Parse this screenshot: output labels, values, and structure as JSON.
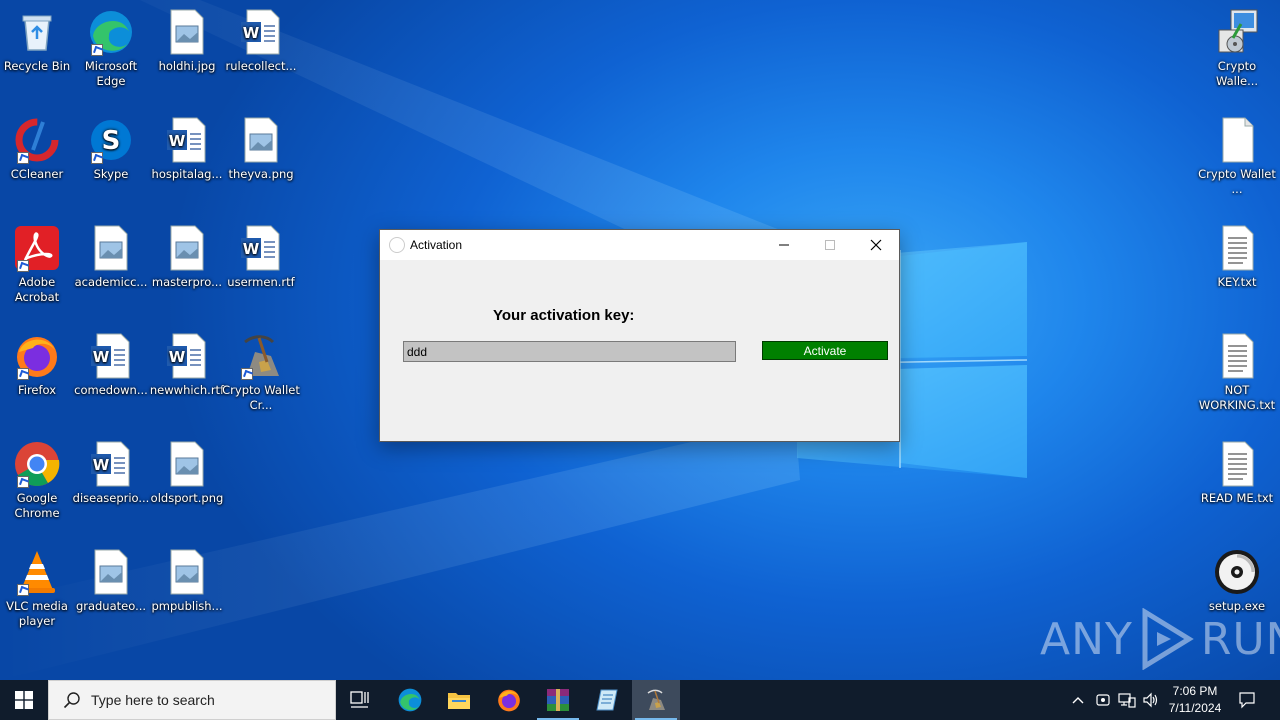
{
  "desktop": {
    "icons": [
      {
        "id": "recycle-bin",
        "label": "Recycle Bin"
      },
      {
        "id": "microsoft-edge",
        "label": "Microsoft Edge"
      },
      {
        "id": "holdhi",
        "label": "holdhi.jpg"
      },
      {
        "id": "rulecollect",
        "label": "rulecollect..."
      },
      {
        "id": "ccleaner",
        "label": "CCleaner"
      },
      {
        "id": "skype",
        "label": "Skype"
      },
      {
        "id": "hospitalag",
        "label": "hospitalag..."
      },
      {
        "id": "theyva",
        "label": "theyva.png"
      },
      {
        "id": "adobe-acrobat",
        "label": "Adobe Acrobat"
      },
      {
        "id": "academicc",
        "label": "academicc..."
      },
      {
        "id": "masterpro",
        "label": "masterpro..."
      },
      {
        "id": "usermen",
        "label": "usermen.rtf"
      },
      {
        "id": "firefox",
        "label": "Firefox"
      },
      {
        "id": "comedown",
        "label": "comedown..."
      },
      {
        "id": "newwhich",
        "label": "newwhich.rtf"
      },
      {
        "id": "crypto-wallet-cr",
        "label": "Crypto Wallet Cr..."
      },
      {
        "id": "google-chrome",
        "label": "Google Chrome"
      },
      {
        "id": "diseasepri",
        "label": "diseaseprio..."
      },
      {
        "id": "oldsport",
        "label": "oldsport.png"
      },
      {
        "id": "vlc",
        "label": "VLC media player"
      },
      {
        "id": "graduateo",
        "label": "graduateo..."
      },
      {
        "id": "pmpublish",
        "label": "pmpublish..."
      },
      {
        "id": "crypto-walle-setup",
        "label": "Crypto Walle..."
      },
      {
        "id": "crypto-wallet-file",
        "label": "Crypto Wallet ..."
      },
      {
        "id": "key-txt",
        "label": "KEY.txt"
      },
      {
        "id": "not-working-txt",
        "label": "NOT WORKING.txt"
      },
      {
        "id": "read-me-txt",
        "label": "READ ME.txt"
      },
      {
        "id": "setup-exe",
        "label": "setup.exe"
      }
    ]
  },
  "window": {
    "title": "Activation",
    "heading": "Your activation key:",
    "key_value": "ddd",
    "activate_label": "Activate"
  },
  "watermark": {
    "left": "ANY",
    "right": "RUN"
  },
  "taskbar": {
    "search_placeholder": "Type here to search",
    "apps": [
      "task-view",
      "microsoft-edge",
      "file-explorer",
      "firefox",
      "winrar",
      "notepad",
      "crypto-wallet"
    ],
    "time": "7:06 PM",
    "date": "7/11/2024"
  },
  "colors": {
    "activate_button": "#008000",
    "taskbar": "#101c2c",
    "desktop": "#0f62d2"
  }
}
